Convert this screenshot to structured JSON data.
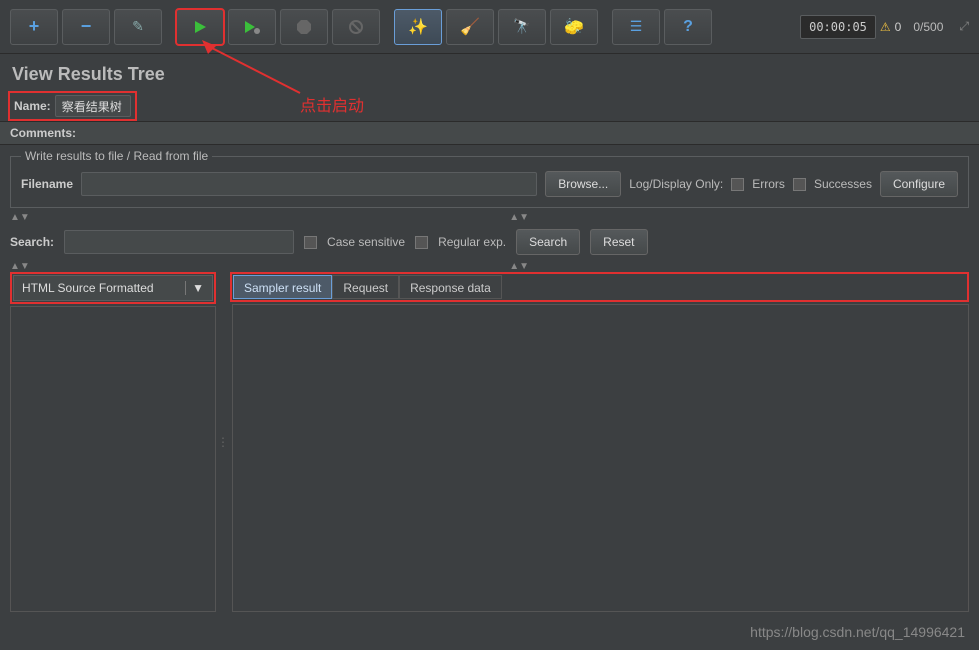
{
  "toolbar": {
    "timer": "00:00:05",
    "warn_count": "0",
    "thread_counter": "0/500"
  },
  "title": "View Results Tree",
  "name": {
    "label": "Name:",
    "value": "察看结果树"
  },
  "comments": {
    "label": "Comments:"
  },
  "fileset": {
    "legend": "Write results to file / Read from file",
    "filename_label": "Filename",
    "browse": "Browse...",
    "logdisplay": "Log/Display Only:",
    "errors": "Errors",
    "successes": "Successes",
    "configure": "Configure"
  },
  "search": {
    "label": "Search:",
    "case_sensitive": "Case sensitive",
    "regex": "Regular exp.",
    "search_btn": "Search",
    "reset_btn": "Reset"
  },
  "renderer": {
    "selected": "HTML Source Formatted"
  },
  "tabs": {
    "sampler": "Sampler result",
    "request": "Request",
    "response": "Response data"
  },
  "annotation": "点击启动",
  "watermark": "https://blog.csdn.net/qq_14996421"
}
